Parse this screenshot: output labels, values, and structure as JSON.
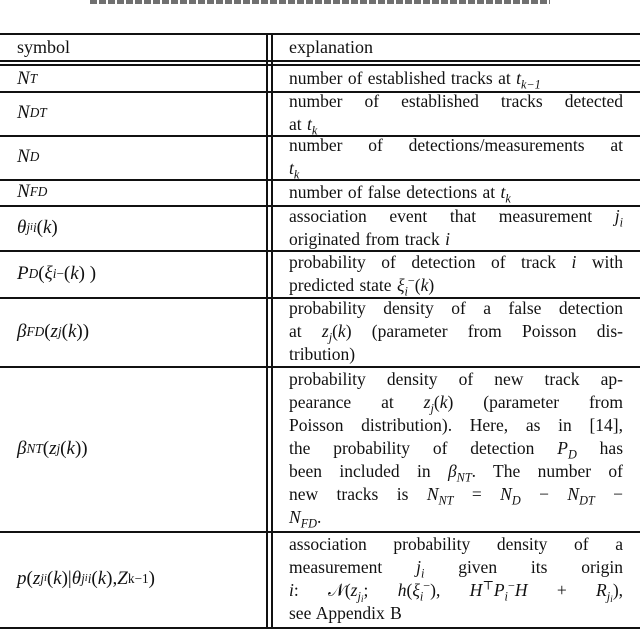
{
  "header": {
    "symbol": "symbol",
    "explanation": "explanation"
  },
  "rows": [
    {
      "symbol": [
        [
          "m",
          "N"
        ],
        [
          "sub",
          "T"
        ]
      ],
      "lines": [
        [
          [
            "r",
            "number of established tracks at "
          ],
          [
            "m",
            "t"
          ],
          [
            "sub",
            "k−1"
          ]
        ]
      ]
    },
    {
      "symbol": [
        [
          "m",
          "N"
        ],
        [
          "sub",
          "DT"
        ]
      ],
      "lines": [
        [
          [
            "r",
            "number of established tracks detected"
          ]
        ],
        [
          [
            "r",
            "at "
          ],
          [
            "m",
            "t"
          ],
          [
            "sub",
            "k"
          ]
        ]
      ]
    },
    {
      "symbol": [
        [
          "m",
          "N"
        ],
        [
          "sub",
          "D"
        ]
      ],
      "lines": [
        [
          [
            "r",
            "number of detections/measurements at"
          ]
        ],
        [
          [
            "m",
            "t"
          ],
          [
            "sub",
            "k"
          ]
        ]
      ]
    },
    {
      "symbol": [
        [
          "m",
          "N"
        ],
        [
          "sub",
          "FD"
        ]
      ],
      "lines": [
        [
          [
            "r",
            "number of false detections at "
          ],
          [
            "m",
            "t"
          ],
          [
            "sub",
            "k"
          ]
        ]
      ]
    },
    {
      "symbol": [
        [
          "m",
          "θ"
        ],
        [
          "sub",
          "j"
        ],
        [
          "subsub",
          "i"
        ],
        [
          "sub",
          "i"
        ],
        [
          "r",
          "("
        ],
        [
          "m",
          "k"
        ],
        [
          "r",
          ")"
        ]
      ],
      "lines": [
        [
          [
            "r",
            "association event that measurement "
          ],
          [
            "m",
            "j"
          ],
          [
            "sub",
            "i"
          ]
        ],
        [
          [
            "r",
            "originated from track "
          ],
          [
            "m",
            "i"
          ]
        ]
      ]
    },
    {
      "symbol": [
        [
          "m",
          "P"
        ],
        [
          "sub",
          "D"
        ],
        [
          "r",
          " ( "
        ],
        [
          "m",
          "ξ"
        ],
        [
          "sub",
          "i"
        ],
        [
          "sup",
          "−"
        ],
        [
          "r",
          "("
        ],
        [
          "m",
          "k"
        ],
        [
          "r",
          ") )"
        ]
      ],
      "lines": [
        [
          [
            "r",
            "probability of detection of track "
          ],
          [
            "m",
            "i"
          ],
          [
            "r",
            " with"
          ]
        ],
        [
          [
            "r",
            "predicted state "
          ],
          [
            "m",
            "ξ"
          ],
          [
            "sub",
            "i"
          ],
          [
            "sup",
            "−"
          ],
          [
            "r",
            "("
          ],
          [
            "m",
            "k"
          ],
          [
            "r",
            ")"
          ]
        ]
      ]
    },
    {
      "symbol": [
        [
          "m",
          "β"
        ],
        [
          "sub",
          "FD"
        ],
        [
          "r",
          " ("
        ],
        [
          "m",
          "z"
        ],
        [
          "sub",
          "j"
        ],
        [
          "r",
          "("
        ],
        [
          "m",
          "k"
        ],
        [
          "r",
          "))"
        ]
      ],
      "lines": [
        [
          [
            "r",
            "probability density of a false detection"
          ]
        ],
        [
          [
            "r",
            "at "
          ],
          [
            "m",
            "z"
          ],
          [
            "sub",
            "j"
          ],
          [
            "r",
            "("
          ],
          [
            "m",
            "k"
          ],
          [
            "r",
            ") (parameter from Poisson dis-"
          ]
        ],
        [
          [
            "r",
            "tribution)"
          ]
        ]
      ]
    },
    {
      "symbol": [
        [
          "m",
          "β"
        ],
        [
          "sub",
          "NT"
        ],
        [
          "r",
          " ("
        ],
        [
          "m",
          "z"
        ],
        [
          "sub",
          "j"
        ],
        [
          "r",
          "("
        ],
        [
          "m",
          "k"
        ],
        [
          "r",
          "))"
        ]
      ],
      "lines": [
        [
          [
            "r",
            "probability density of new track ap-"
          ]
        ],
        [
          [
            "r",
            "pearance at "
          ],
          [
            "m",
            "z"
          ],
          [
            "sub",
            "j"
          ],
          [
            "r",
            "("
          ],
          [
            "m",
            "k"
          ],
          [
            "r",
            ") (parameter from"
          ]
        ],
        [
          [
            "r",
            "Poisson distribution). Here, as in [14],"
          ]
        ],
        [
          [
            "r",
            "the probability of detection "
          ],
          [
            "m",
            "P"
          ],
          [
            "sub",
            "D"
          ],
          [
            "r",
            " has"
          ]
        ],
        [
          [
            "r",
            "been included in "
          ],
          [
            "m",
            "β"
          ],
          [
            "sub",
            "NT"
          ],
          [
            "r",
            ". The number of"
          ]
        ],
        [
          [
            "r",
            "new tracks is "
          ],
          [
            "m",
            "N"
          ],
          [
            "sub",
            "NT"
          ],
          [
            "r",
            " = "
          ],
          [
            "m",
            "N"
          ],
          [
            "sub",
            "D"
          ],
          [
            "r",
            " − "
          ],
          [
            "m",
            "N"
          ],
          [
            "sub",
            "DT"
          ],
          [
            "r",
            " −"
          ]
        ],
        [
          [
            "m",
            "N"
          ],
          [
            "sub",
            "FD"
          ],
          [
            "r",
            "."
          ]
        ]
      ]
    },
    {
      "symbol": [
        [
          "m",
          "p"
        ],
        [
          "r",
          " ("
        ],
        [
          "m",
          "z"
        ],
        [
          "sub",
          "j"
        ],
        [
          "subsub",
          "i"
        ],
        [
          "r",
          "("
        ],
        [
          "m",
          "k"
        ],
        [
          "r",
          ")|"
        ],
        [
          "m",
          "θ"
        ],
        [
          "sub",
          "j"
        ],
        [
          "subsub",
          "i"
        ],
        [
          "sub",
          "i"
        ],
        [
          "r",
          "("
        ],
        [
          "m",
          "k"
        ],
        [
          "r",
          "), "
        ],
        [
          "m",
          "Z"
        ],
        [
          "sup",
          "k−1"
        ],
        [
          "r",
          ")"
        ]
      ],
      "lines": [
        [
          [
            "r",
            "association probability density of a"
          ]
        ],
        [
          [
            "r",
            "measurement "
          ],
          [
            "m",
            "j"
          ],
          [
            "sub",
            "i"
          ],
          [
            "r",
            " given its origin"
          ]
        ],
        [
          [
            "m",
            "i"
          ],
          [
            "r",
            ": 𝒩("
          ],
          [
            "m",
            "z"
          ],
          [
            "sub",
            "j"
          ],
          [
            "subsub",
            "i"
          ],
          [
            "r",
            "; "
          ],
          [
            "m",
            "h"
          ],
          [
            "r",
            "("
          ],
          [
            "m",
            "ξ"
          ],
          [
            "sub",
            "i"
          ],
          [
            "sup",
            "−"
          ],
          [
            "r",
            "), "
          ],
          [
            "m",
            "H"
          ],
          [
            "sup",
            "⊤"
          ],
          [
            "m",
            "P"
          ],
          [
            "sub",
            "i"
          ],
          [
            "sup",
            "−"
          ],
          [
            "m",
            "H"
          ],
          [
            "r",
            " + "
          ],
          [
            "m",
            "R"
          ],
          [
            "sub",
            "j"
          ],
          [
            "subsub",
            "i"
          ],
          [
            "r",
            "),"
          ]
        ],
        [
          [
            "r",
            "see Appendix B"
          ]
        ]
      ]
    }
  ]
}
